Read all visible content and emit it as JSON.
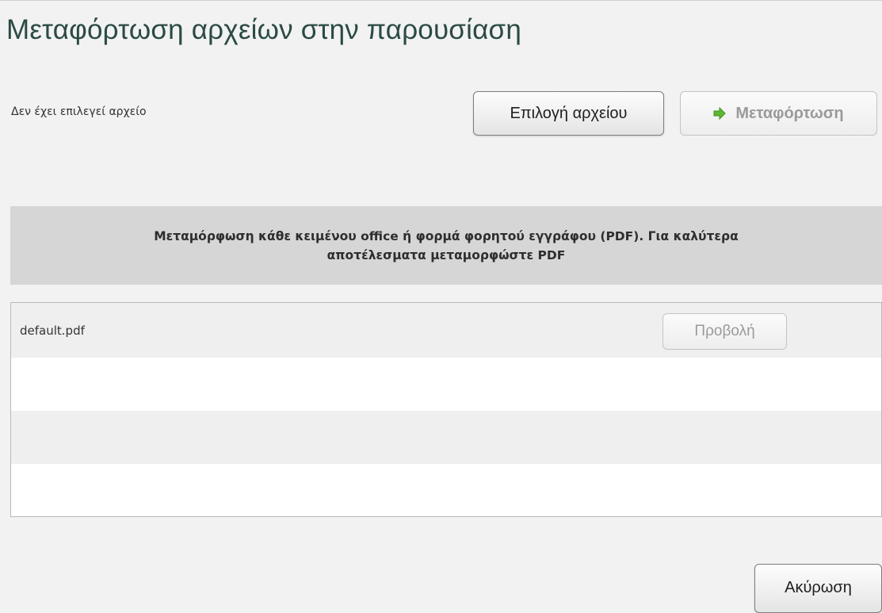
{
  "dialog": {
    "title": "Μεταφόρτωση αρχείων στην παρουσίαση"
  },
  "file_picker": {
    "status": "Δεν έχει επιλεγεί αρχείο",
    "choose_label": "Επιλογή αρχείου",
    "upload_label": "Μεταφόρτωση",
    "upload_enabled": false,
    "upload_icon": "green-right-arrow-icon"
  },
  "info": {
    "text": "Μεταμόρφωση κάθε κειμένου office ή φορμά φορητού εγγράφου (PDF). Για καλύτερα αποτέλεσματα μεταμορφώστε PDF"
  },
  "files": [
    {
      "name": "default.pdf",
      "view_label": "Προβολή",
      "view_enabled": false
    }
  ],
  "footer": {
    "cancel_label": "Ακύρωση"
  },
  "colors": {
    "title": "#2b4a44",
    "banner_bg": "#d6d6d6",
    "arrow": "#5cb82e",
    "alt_row": "#efefef"
  }
}
